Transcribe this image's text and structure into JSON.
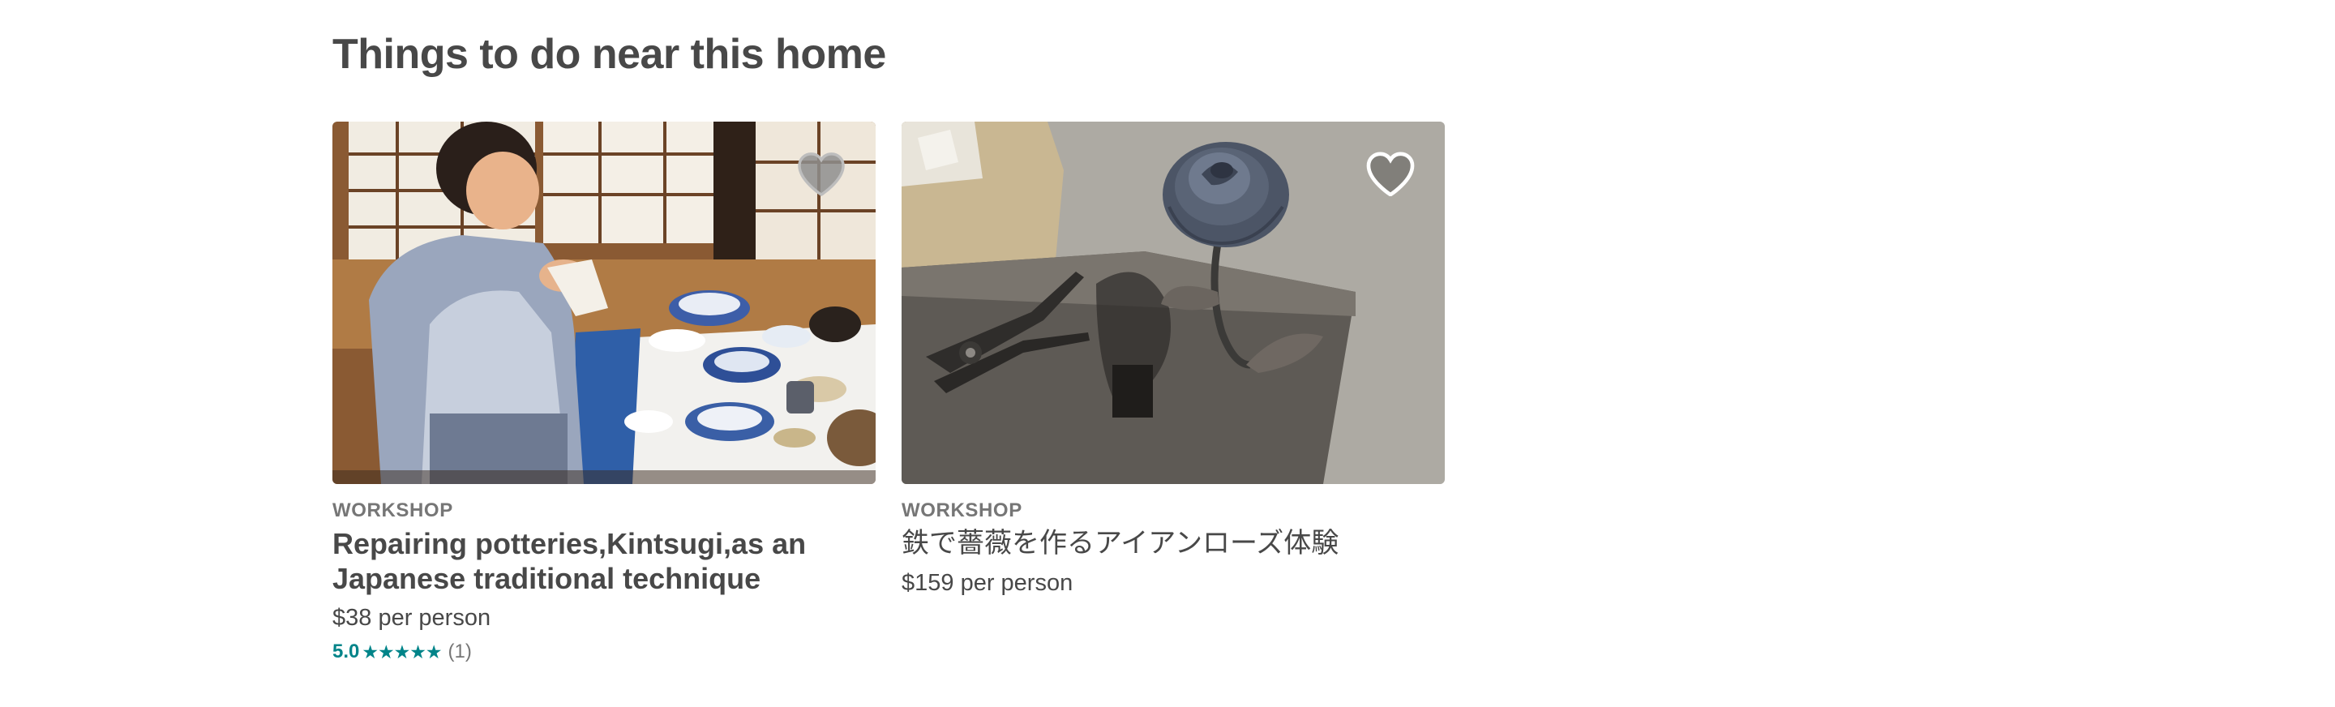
{
  "section": {
    "title": "Things to do near this home"
  },
  "cards": [
    {
      "category": "WORKSHOP",
      "title": "Repairing potteries,Kintsugi,as an Japanese traditional technique",
      "price": "$38 per person",
      "rating": {
        "score": "5.0",
        "stars": "★★★★★",
        "count": "(1)"
      },
      "favorite_icon": "heart-icon"
    },
    {
      "category": "WORKSHOP",
      "title": "鉄で薔薇を作るアイアンローズ体験",
      "price": "$159 per person",
      "favorite_icon": "heart-outline-icon"
    }
  ],
  "colors": {
    "text": "#484848",
    "muted": "#767676",
    "rating_accent": "#008489"
  }
}
